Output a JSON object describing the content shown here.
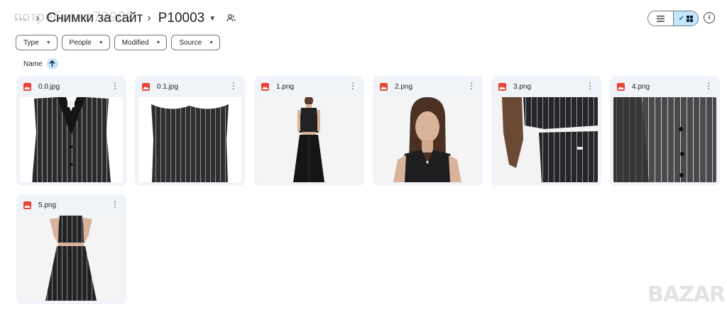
{
  "breadcrumb": {
    "more": "···",
    "folder": "Снимки за сайт",
    "current": "P10003",
    "watermark": "потребител72902"
  },
  "filters": [
    "Type",
    "People",
    "Modified",
    "Source"
  ],
  "sort": {
    "label": "Name"
  },
  "watermark_corner": "BAZAR",
  "files": [
    {
      "name": "0.0.jpg"
    },
    {
      "name": "0.1.jpg"
    },
    {
      "name": "1.png"
    },
    {
      "name": "2.png"
    },
    {
      "name": "3.png"
    },
    {
      "name": "4.png"
    },
    {
      "name": "5.png"
    }
  ],
  "colors": {
    "accent": "#c2e7ff",
    "card_bg": "#f0f4f9",
    "file_icon": "#ea4335"
  }
}
